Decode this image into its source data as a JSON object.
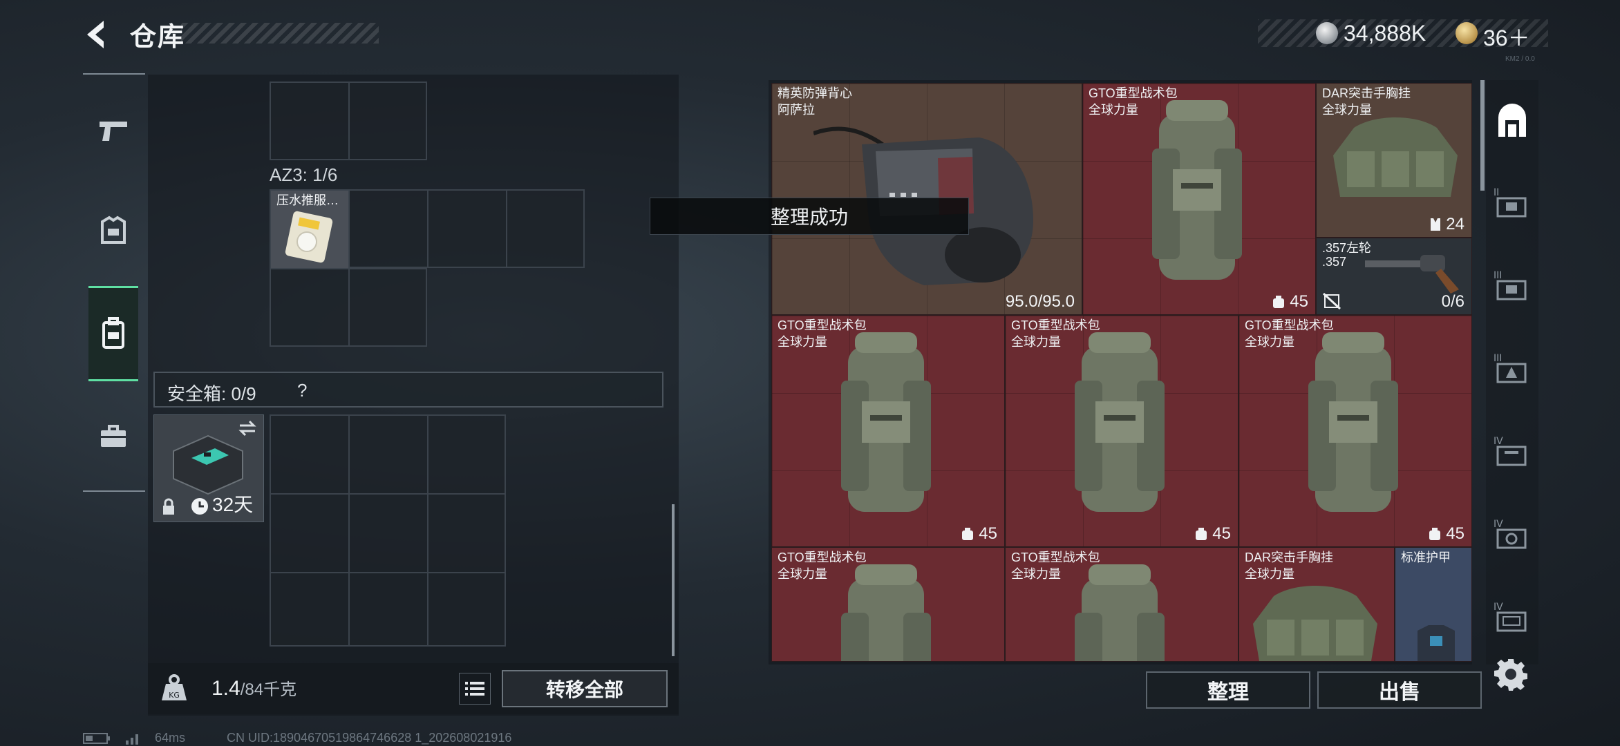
{
  "header": {
    "title": "仓库",
    "back_icon": "back-arrow-icon",
    "currency_1": {
      "value": "34,888K",
      "icon": "silver-coin-icon"
    },
    "currency_2": {
      "value": "36＋",
      "icon": "gold-token-icon"
    },
    "watermark": "KM2 / 0.0"
  },
  "left_sidebar": [
    {
      "icon": "pistol-icon",
      "active": false
    },
    {
      "icon": "armor-icon",
      "active": false
    },
    {
      "icon": "backpack-icon",
      "active": true
    },
    {
      "icon": "briefcase-icon",
      "active": false
    }
  ],
  "left_panel": {
    "az3_label": "AZ3: 1/6",
    "az3_item": {
      "name": "压水推服…"
    },
    "safebox_label": "安全箱: 0/9",
    "safebox_help": "?",
    "safebox_item": {
      "days": "32天",
      "swap_icon": "swap-icon",
      "lock_icon": "lock-icon",
      "clock_icon": "clock-icon"
    }
  },
  "bottom_left": {
    "weight_current": "1.4",
    "weight_max": "/84千克",
    "transfer_all": "转移全部"
  },
  "toast": "整理成功",
  "items": [
    {
      "name": "精英防弹背心",
      "sub": "阿萨拉",
      "value": "95.0/95.0",
      "color": "brown"
    },
    {
      "name": "GTO重型战术包",
      "sub": "全球力量",
      "value": "45",
      "color": "red"
    },
    {
      "name": "DAR突击手胸挂",
      "sub": "全球力量",
      "value": "24",
      "color": "brown"
    },
    {
      "name": ".357左轮",
      "sub": ".357",
      "value": "0/6",
      "color": "dark"
    },
    {
      "name": "GTO重型战术包",
      "sub": "全球力量",
      "value": "45",
      "color": "red"
    },
    {
      "name": "GTO重型战术包",
      "sub": "全球力量",
      "value": "45",
      "color": "red"
    },
    {
      "name": "GTO重型战术包",
      "sub": "全球力量",
      "value": "45",
      "color": "red"
    },
    {
      "name": "GTO重型战术包",
      "sub": "全球力量",
      "value": "",
      "color": "red"
    },
    {
      "name": "GTO重型战术包",
      "sub": "全球力量",
      "value": "",
      "color": "red"
    },
    {
      "name": "DAR突击手胸挂",
      "sub": "全球力量",
      "value": "",
      "color": "red"
    },
    {
      "name": "标准护甲",
      "sub": "",
      "value": "",
      "color": "blue"
    }
  ],
  "right_sidebar": [
    {
      "icon": "safehouse-icon"
    },
    {
      "icon": "storage-tier-2-icon",
      "label": "II"
    },
    {
      "icon": "storage-tier-3-icon",
      "label": "III"
    },
    {
      "icon": "storage-tier-3b-icon",
      "label": "III"
    },
    {
      "icon": "storage-tier-4-icon",
      "label": "IV"
    },
    {
      "icon": "storage-tier-4b-icon",
      "label": "IV"
    },
    {
      "icon": "storage-tier-4c-icon",
      "label": "IV"
    }
  ],
  "bottom_right": {
    "sort": "整理",
    "sell": "出售"
  },
  "status_bar": {
    "ping": "64ms",
    "uid": "CN UID:18904670519864746628 1_202608021916"
  },
  "colors": {
    "accent_green": "#5fe0a3",
    "item_red": "#6a2b31",
    "item_brown": "#55433a",
    "item_blue": "#3c4a64"
  }
}
